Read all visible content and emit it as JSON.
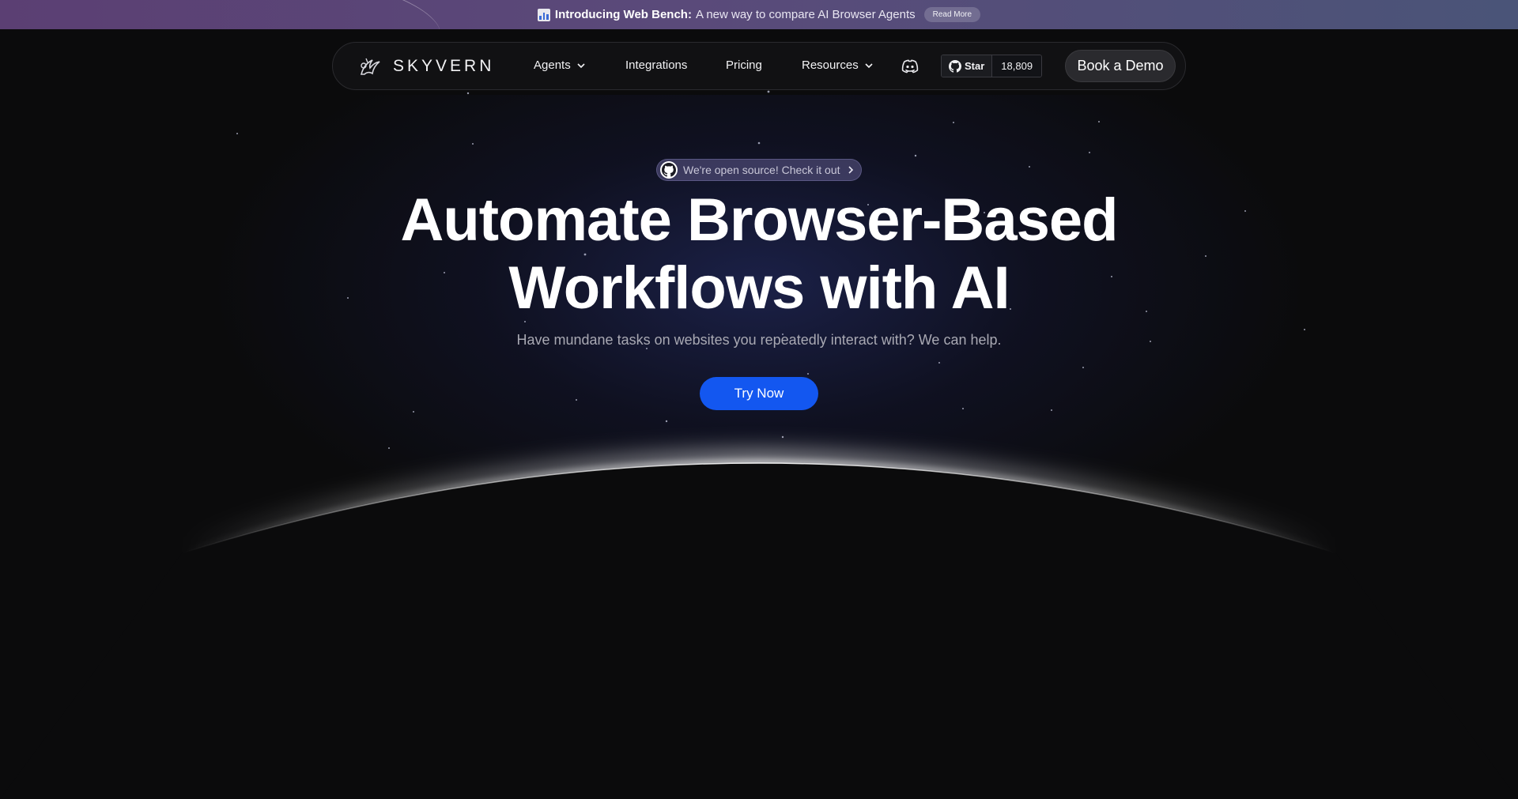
{
  "announcement": {
    "icon": "bar-chart-icon",
    "title": "Introducing Web Bench:",
    "text": "A new way to compare AI Browser Agents",
    "read_more": "Read More"
  },
  "nav": {
    "logo_text": "SKYVERN",
    "items": [
      {
        "label": "Agents",
        "has_dropdown": true
      },
      {
        "label": "Integrations",
        "has_dropdown": false
      },
      {
        "label": "Pricing",
        "has_dropdown": false
      },
      {
        "label": "Resources",
        "has_dropdown": true
      }
    ],
    "discord_icon": "discord-icon",
    "github": {
      "star_label": "Star",
      "count": "18,809"
    },
    "book_demo": "Book a Demo"
  },
  "hero": {
    "badge_text": "We're open source! Check it out",
    "headline_line1": "Automate Browser-Based",
    "headline_line2": "Workflows with AI",
    "subhead": "Have mundane tasks on websites you repeatedly interact with? We can help.",
    "cta": "Try Now"
  },
  "colors": {
    "background": "#0b0b0c",
    "announcement_start": "#5b3f73",
    "announcement_end": "#4a5478",
    "cta": "#1357f0"
  }
}
